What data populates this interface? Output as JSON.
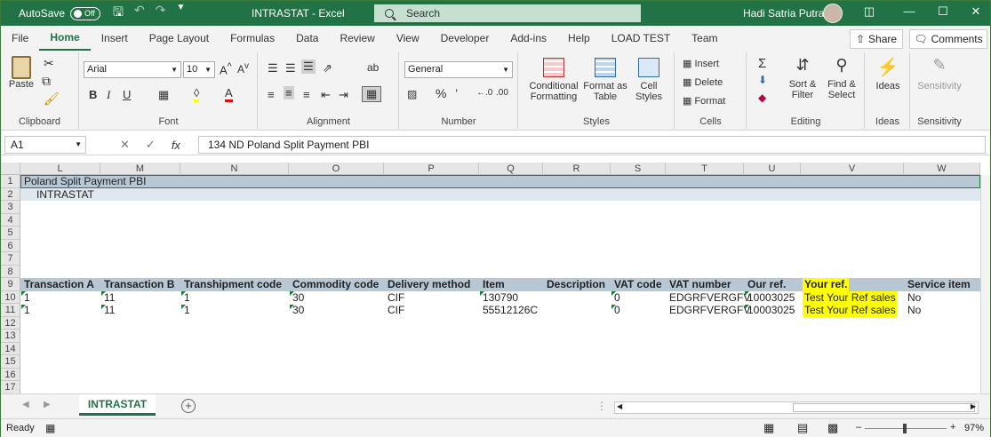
{
  "titlebar": {
    "autosave_label": "AutoSave",
    "autosave_state": "Off",
    "doc_title": "INTRASTAT  -  Excel",
    "search_placeholder": "Search",
    "user_name": "Hadi Satria Putra",
    "accent": "#217346"
  },
  "tabs": [
    "File",
    "Home",
    "Insert",
    "Page Layout",
    "Formulas",
    "Data",
    "Review",
    "View",
    "Developer",
    "Add-ins",
    "Help",
    "LOAD TEST",
    "Team"
  ],
  "active_tab": "Home",
  "share_label": "Share",
  "comments_label": "Comments",
  "ribbon": {
    "clipboard": {
      "label": "Clipboard",
      "paste": "Paste"
    },
    "font": {
      "label": "Font",
      "name": "Arial",
      "size": "10"
    },
    "alignment": {
      "label": "Alignment"
    },
    "number": {
      "label": "Number",
      "format": "General"
    },
    "styles": {
      "label": "Styles",
      "conditional": "Conditional",
      "formatting": "Formatting",
      "format_as": "Format as",
      "table": "Table",
      "cell": "Cell",
      "styles": "Styles"
    },
    "cells": {
      "label": "Cells",
      "insert": "Insert",
      "delete": "Delete",
      "format": "Format"
    },
    "editing": {
      "label": "Editing",
      "sort": "Sort &",
      "filter": "Filter",
      "find": "Find &",
      "select": "Select"
    },
    "ideas": {
      "label": "Ideas",
      "button": "Ideas"
    },
    "sensitivity": {
      "label": "Sensitivity",
      "button": "Sensitivity"
    }
  },
  "formula_bar": {
    "name_box": "A1",
    "formula": "134  ND Poland Split Payment PBI"
  },
  "columns": [
    "L",
    "M",
    "N",
    "O",
    "P",
    "Q",
    "R",
    "S",
    "T",
    "U",
    "V",
    "W"
  ],
  "rows": [
    "1",
    "2",
    "3",
    "4",
    "5",
    "6",
    "7",
    "8",
    "9",
    "10",
    "11",
    "12",
    "13",
    "14",
    "15",
    "16",
    "17"
  ],
  "sheet": {
    "r1": "Poland Split Payment PBI",
    "r2": "INTRASTAT",
    "headers": [
      "Transaction A",
      "Transaction B",
      "Transhipment code",
      "Commodity code",
      "Delivery method",
      "Item",
      "Description",
      "VAT code",
      "VAT number",
      "Our ref.",
      "Your ref.",
      "Service item"
    ],
    "data": [
      [
        "1",
        "11",
        "1",
        "30",
        "CIF",
        "130790",
        "",
        "0",
        "EDGRFVERGFV",
        "10003025",
        "Test Your Ref sales",
        "No"
      ],
      [
        "1",
        "11",
        "1",
        "30",
        "CIF",
        "55512126C",
        "",
        "0",
        "EDGRFVERGFV",
        "10003025",
        "Test Your Ref sales",
        "No"
      ]
    ]
  },
  "sheet_tab": "INTRASTAT",
  "status": {
    "ready": "Ready",
    "zoom": "97%"
  }
}
